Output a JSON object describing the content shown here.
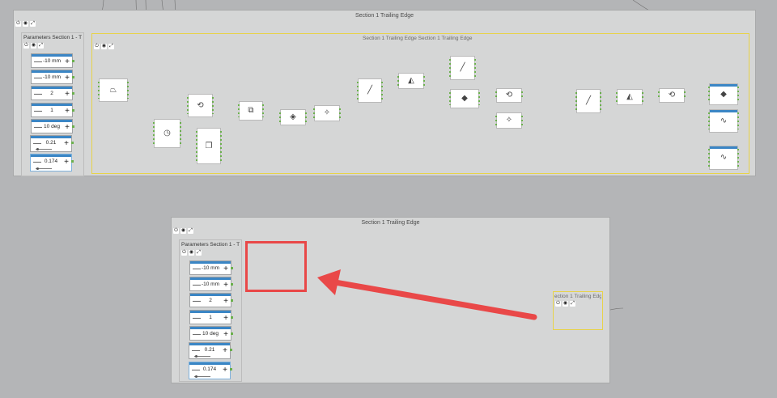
{
  "top_panel": {
    "title": "Section 1 Trailing Edge",
    "params_label": "Parameters   Section 1 - T",
    "frame_title": "Section 1 Trailing Edge   Section 1 Trailing Edge"
  },
  "bottom_panel": {
    "title": "Section 1 Trailing Edge",
    "params_label": "Parameters   Section 1 - T",
    "collapsed_node_label": "ection 1 Trailing Edg"
  },
  "toolbar_icons": [
    "power-icon",
    "eye-icon",
    "expand-icon"
  ],
  "parameters": [
    {
      "value": "-10 mm",
      "slider": false
    },
    {
      "value": "-10 mm",
      "slider": false
    },
    {
      "value": "2",
      "slider": false
    },
    {
      "value": "1",
      "slider": false
    },
    {
      "value": "10 deg",
      "slider": false
    },
    {
      "value": "0.21",
      "slider": true,
      "slider_fraction": 0.1
    },
    {
      "value": "0.174",
      "slider": true,
      "slider_fraction": 0.1
    }
  ],
  "stepper_symbols": {
    "minus": "—",
    "plus": "+"
  },
  "colors": {
    "background": "#b4b5b7",
    "panel": "#d5d6d6",
    "frame": "#e7d349",
    "accent_blue": "#3b86c5",
    "port_green": "#6ab04c",
    "annotation_red": "#e94848"
  }
}
